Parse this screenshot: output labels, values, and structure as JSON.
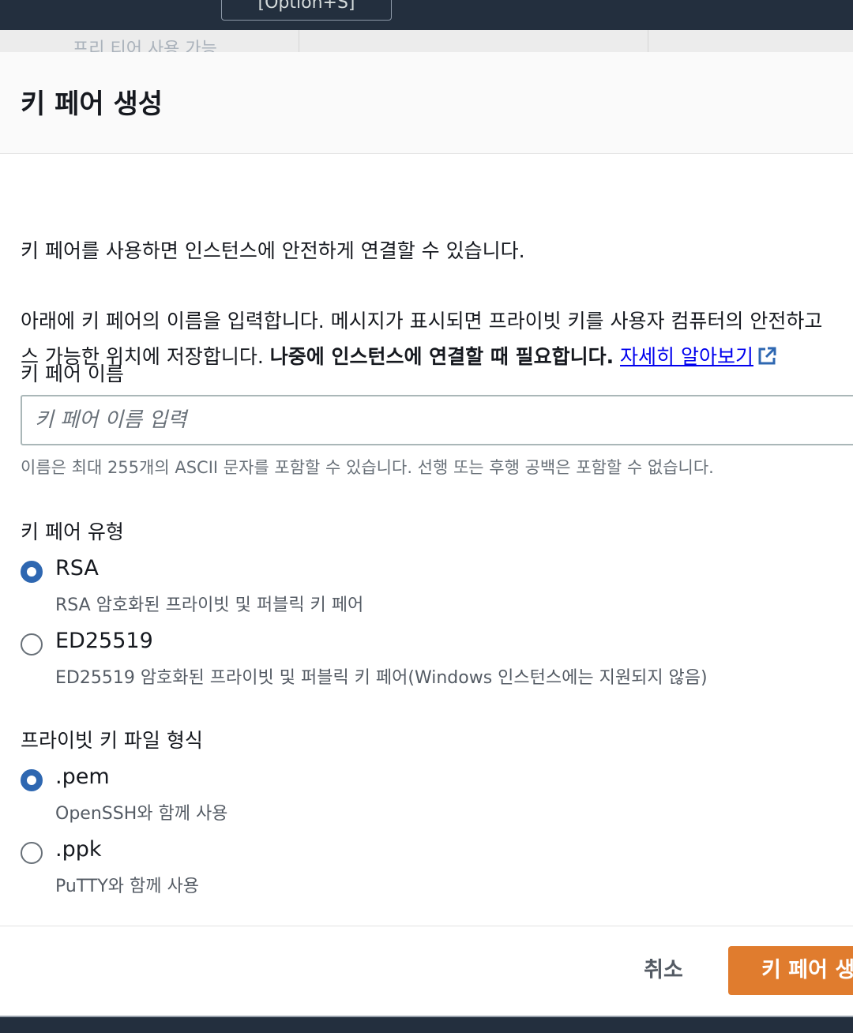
{
  "background": {
    "option_button": "[Option+S]",
    "behind_text": "프리 티어 사용 가능"
  },
  "modal": {
    "title": "키 페어 생성",
    "intro": "키 페어를 사용하면 인스턴스에 안전하게 연결할 수 있습니다.",
    "instructions_line1": "아래에 키 페어의 이름을 입력합니다. 메시지가 표시되면 프라이빗 키를 사용자 컴퓨터의 안전하고",
    "instructions_line2_prefix": "스 가능한 위치에 저장합니다. ",
    "instructions_bold": "나중에 인스턴스에 연결할 때 필요합니다.",
    "learn_more": "자세히 알아보기"
  },
  "key_name": {
    "label": "키 페어 이름",
    "placeholder": "키 페어 이름 입력",
    "value": "",
    "hint": "이름은 최대 255개의 ASCII 문자를 포함할 수 있습니다. 선행 또는 후행 공백은 포함할 수 없습니다."
  },
  "key_type": {
    "label": "키 페어 유형",
    "options": [
      {
        "label": "RSA",
        "description": "RSA 암호화된 프라이빗 및 퍼블릭 키 페어",
        "selected": true
      },
      {
        "label": "ED25519",
        "description": "ED25519 암호화된 프라이빗 및 퍼블릭 키 페어(Windows 인스턴스에는 지원되지 않음)",
        "selected": false
      }
    ]
  },
  "file_format": {
    "label": "프라이빗 키 파일 형식",
    "options": [
      {
        "label": ".pem",
        "description": "OpenSSH와 함께 사용",
        "selected": true
      },
      {
        "label": ".ppk",
        "description": "PuTTY와 함께 사용",
        "selected": false
      }
    ]
  },
  "footer": {
    "cancel": "취소",
    "create": "키 페어 생성"
  },
  "colors": {
    "accent": "#2e67b1",
    "primary_button": "#e07c2e",
    "link": "#0000ee",
    "topbar": "#232f3e"
  }
}
